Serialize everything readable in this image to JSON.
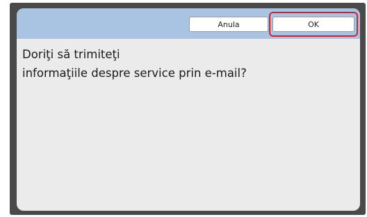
{
  "dialog": {
    "buttons": {
      "cancel_label": "Anula",
      "ok_label": "OK"
    },
    "message_lines": [
      "Doriţi să trimiteţi",
      "informaţiile despre service prin e-mail?"
    ],
    "colors": {
      "header": "#a9c3e3",
      "body": "#ebebeb",
      "frame": "#4a4a4a",
      "highlight": "#d3202e"
    }
  }
}
